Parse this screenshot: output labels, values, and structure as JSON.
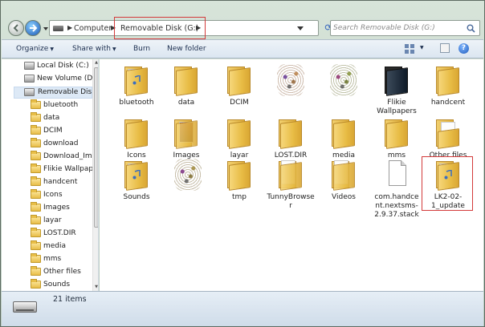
{
  "address": {
    "crumbs": [
      "Computer",
      "Removable Disk (G:)"
    ],
    "search_placeholder": "Search Removable Disk (G:)"
  },
  "toolbar": {
    "organize": "Organize",
    "share_with": "Share with",
    "burn": "Burn",
    "new_folder": "New folder"
  },
  "nav": {
    "items": [
      {
        "label": "Local Disk (C:)",
        "icon": "drive-icon",
        "selected": false
      },
      {
        "label": "New Volume (D:)",
        "icon": "drive-icon",
        "selected": false
      },
      {
        "label": "Removable Disk (",
        "icon": "usb-drive-icon",
        "selected": true
      },
      {
        "label": "bluetooth",
        "icon": "folder-icon"
      },
      {
        "label": "data",
        "icon": "folder-icon"
      },
      {
        "label": "DCIM",
        "icon": "folder-icon"
      },
      {
        "label": "download",
        "icon": "folder-icon"
      },
      {
        "label": "Download_Ima",
        "icon": "folder-icon"
      },
      {
        "label": "Flikie Wallpape",
        "icon": "folder-icon"
      },
      {
        "label": "handcent",
        "icon": "folder-icon"
      },
      {
        "label": "Icons",
        "icon": "folder-icon"
      },
      {
        "label": "Images",
        "icon": "folder-icon"
      },
      {
        "label": "layar",
        "icon": "folder-icon"
      },
      {
        "label": "LOST.DIR",
        "icon": "folder-icon"
      },
      {
        "label": "media",
        "icon": "folder-icon"
      },
      {
        "label": "mms",
        "icon": "folder-icon"
      },
      {
        "label": "Other files",
        "icon": "folder-icon"
      },
      {
        "label": "Sounds",
        "icon": "folder-icon"
      }
    ]
  },
  "files": [
    {
      "label": "bluetooth",
      "type": "folder-music"
    },
    {
      "label": "data",
      "type": "folder"
    },
    {
      "label": "DCIM",
      "type": "folder"
    },
    {
      "label": "",
      "type": "folder-noise-purple"
    },
    {
      "label": "",
      "type": "folder-noise-brown"
    },
    {
      "label": "Flikie Wallpapers",
      "type": "folder-dark"
    },
    {
      "label": "handcent",
      "type": "folder"
    },
    {
      "label": "Icons",
      "type": "folder"
    },
    {
      "label": "Images",
      "type": "folder-images"
    },
    {
      "label": "layar",
      "type": "folder"
    },
    {
      "label": "LOST.DIR",
      "type": "folder"
    },
    {
      "label": "media",
      "type": "folder"
    },
    {
      "label": "mms",
      "type": "folder"
    },
    {
      "label": "Other files",
      "type": "folder-open"
    },
    {
      "label": "Sounds",
      "type": "folder-music"
    },
    {
      "label": "",
      "type": "folder-noise-brown"
    },
    {
      "label": "tmp",
      "type": "folder"
    },
    {
      "label": "TunnyBrowser",
      "type": "folder-white"
    },
    {
      "label": "Videos",
      "type": "folder-white"
    },
    {
      "label": "com.handcent.nextsms-2.9.37.stack",
      "type": "document"
    },
    {
      "label": "LK2-02-1_update",
      "type": "folder-music"
    }
  ],
  "status": {
    "count_text": "21 items"
  },
  "colors": {
    "highlight": "#d33a3a",
    "selection": "#dde9f6",
    "folder": "#e8bc45"
  }
}
